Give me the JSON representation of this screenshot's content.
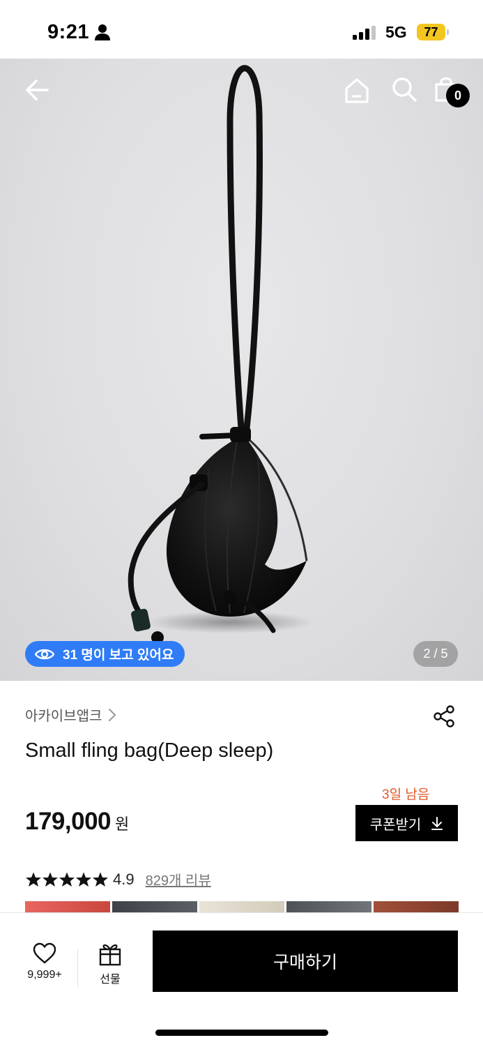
{
  "status_bar": {
    "time": "9:21",
    "network": "5G",
    "battery": "77"
  },
  "hero": {
    "cart_count": "0",
    "viewers_text": "31 명이 보고 있어요",
    "page_indicator": "2 / 5"
  },
  "product": {
    "brand": "아카이브앱크",
    "title": "Small fling bag(Deep sleep)",
    "coupon_timer": "3일 남음",
    "price": "179,000",
    "currency": "원",
    "coupon_button": "쿠폰받기",
    "rating": "4.9",
    "review_link": "829개 리뷰"
  },
  "action_bar": {
    "wish_count": "9,999+",
    "gift_label": "선물",
    "buy_label": "구매하기"
  },
  "colors": {
    "accent_blue": "#2f7cf6",
    "coupon_timer": "#e0582a",
    "battery": "#f3c61f"
  },
  "icons": [
    "person-icon",
    "signal-icon",
    "back-icon",
    "home-icon",
    "search-icon",
    "bag-icon",
    "eye-icon",
    "chevron-right-icon",
    "share-icon",
    "star-icon",
    "download-icon",
    "heart-icon",
    "gift-icon"
  ]
}
